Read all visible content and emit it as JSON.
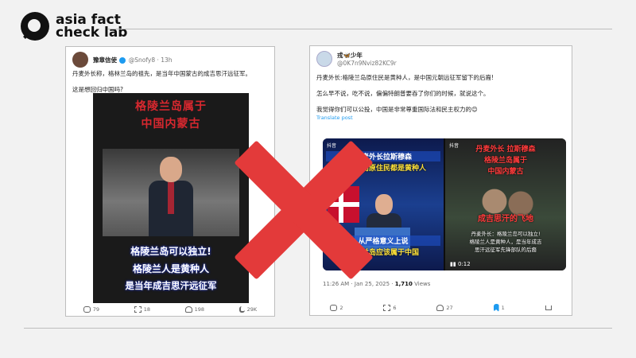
{
  "brand": {
    "line1": "asia fact",
    "line2": "check lab"
  },
  "left_post": {
    "display_name": "豫章信使",
    "handle_time": "@Snofy8 · 13h",
    "text_line1": "丹麦外长称，格林兰岛的祖先，是当年中国蒙古的成吉思汗远征军。",
    "text_line2": "这是想回归中国吗?",
    "media": {
      "title_line1": "格陵兰岛属于",
      "title_line2": "中国内蒙古",
      "sub1": "格陵兰岛可以独立!",
      "sub2": "格陵兰人是黄种人",
      "sub3": "是当年成吉思汗远征军"
    },
    "actions": {
      "replies": "79",
      "reposts": "18",
      "likes": "198",
      "views": "29K"
    }
  },
  "right_post": {
    "display_name": "戎🦋少年",
    "handle": "@0K7n9Nviz82KC9r",
    "text_line1": "丹麦外长:格陵兰岛原住民是黄种人，是中国元朝远征军留下的后裔!",
    "text_line2": "怎么早不说，吃不说，偏偏特朗普要吞了你们的时候，就说这个。",
    "text_line3": "我觉得你们可以公投，中国是非常尊重国际法和民主权力的😊",
    "translate": "Translate post",
    "clip_a": {
      "tiktok": "抖音",
      "title1": "丹麦外长拉斯穆森",
      "title2": "格陵兰岛原住民都是黄种人",
      "caption1": "从严格意义上说",
      "caption2": "格陵兰岛应该属于中国"
    },
    "clip_b": {
      "tiktok": "抖音",
      "title1": "丹麦外长 拉斯穆森",
      "title2": "格陵兰岛属于",
      "title3": "中国内蒙古",
      "red_caption": "成吉思汗的飞地",
      "caption1": "丹麦外长：格陵兰岛可以独立!",
      "caption2": "格陵兰人是黄种人，是当年成吉",
      "caption3": "思汗远征军先锋部队的后裔",
      "time": "0:12"
    },
    "timestamp": "11:26 AM · Jan 25, 2025 ·",
    "views_count": "1,710",
    "views_label": "Views",
    "actions": {
      "replies": "2",
      "reposts": "6",
      "likes": "27",
      "bookmarks": "1"
    }
  },
  "colors": {
    "cross": "#e33a3a",
    "link": "#1d9bf0"
  }
}
